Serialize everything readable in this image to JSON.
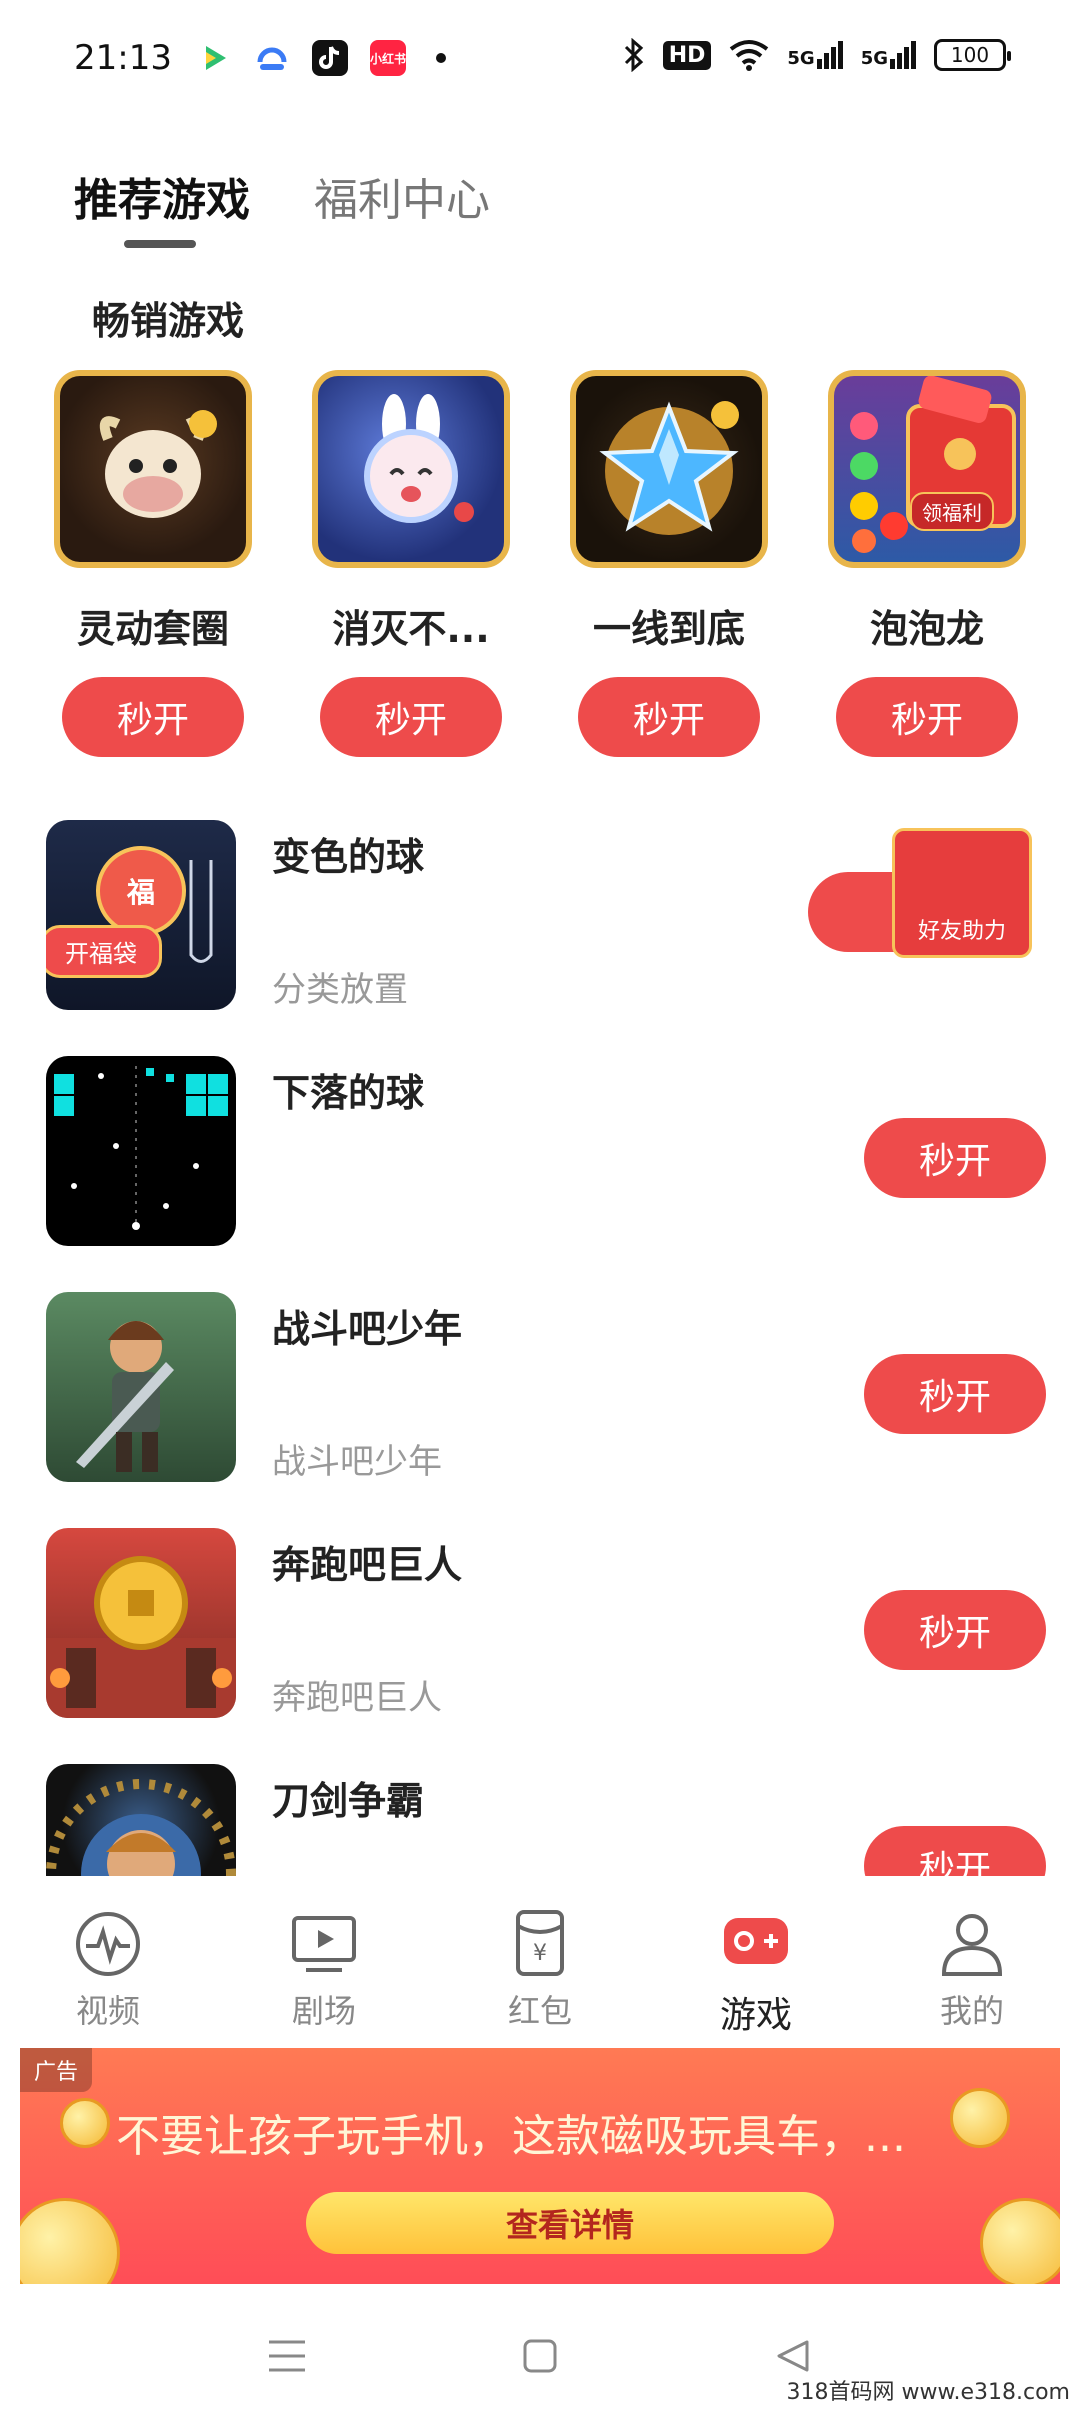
{
  "status_bar": {
    "time": "21:13",
    "apps": [
      {
        "name": "tencent-video-icon",
        "color": "#2fbf71"
      },
      {
        "name": "baidu-netdisk-icon",
        "color": "#3b7bf5"
      },
      {
        "name": "douyin-icon",
        "color": "#111111"
      },
      {
        "name": "xiaohongshu-icon",
        "color": "#ff2442",
        "label": "小红书"
      }
    ],
    "hd_label": "HD",
    "signal_label_1": "5G",
    "signal_label_2": "5G",
    "battery": "100"
  },
  "tabs": [
    {
      "label": "推荐游戏",
      "active": true
    },
    {
      "label": "福利中心",
      "active": false
    }
  ],
  "section_title": "畅销游戏",
  "best_sellers": [
    {
      "name": "灵动套圈",
      "button": "秒开"
    },
    {
      "name": "消灭不...",
      "button": "秒开"
    },
    {
      "name": "一线到底",
      "button": "秒开"
    },
    {
      "name": "泡泡龙",
      "button": "秒开",
      "badge": "领福利"
    }
  ],
  "games": [
    {
      "title": "变色的球",
      "subtitle": "分类放置",
      "badge": "开福袋",
      "bag_char": "福"
    },
    {
      "title": "下落的球",
      "subtitle": "",
      "button": "秒开"
    },
    {
      "title": "战斗吧少年",
      "subtitle": "战斗吧少年",
      "button": "秒开"
    },
    {
      "title": "奔跑吧巨人",
      "subtitle": "奔跑吧巨人",
      "button": "秒开"
    },
    {
      "title": "刀剑争霸",
      "subtitle": "",
      "button": "秒开"
    }
  ],
  "friend_help": {
    "label": "好友助力"
  },
  "bottom_nav": [
    {
      "label": "视频",
      "icon": "pulse-icon",
      "active": false
    },
    {
      "label": "剧场",
      "icon": "tv-icon",
      "active": false
    },
    {
      "label": "红包",
      "icon": "red-envelope-icon",
      "active": false
    },
    {
      "label": "游戏",
      "icon": "gamepad-icon",
      "active": true
    },
    {
      "label": "我的",
      "icon": "person-icon",
      "active": false
    }
  ],
  "ad": {
    "tag": "广告",
    "text": "不要让孩子玩手机，这款磁吸玩具车，...",
    "button": "查看详情"
  },
  "watermark": "318首码网 www.e318.com",
  "colors": {
    "accent_red": "#ee4b4b",
    "active_nav": "#ee4b4b",
    "gold": "#e8b54a"
  }
}
